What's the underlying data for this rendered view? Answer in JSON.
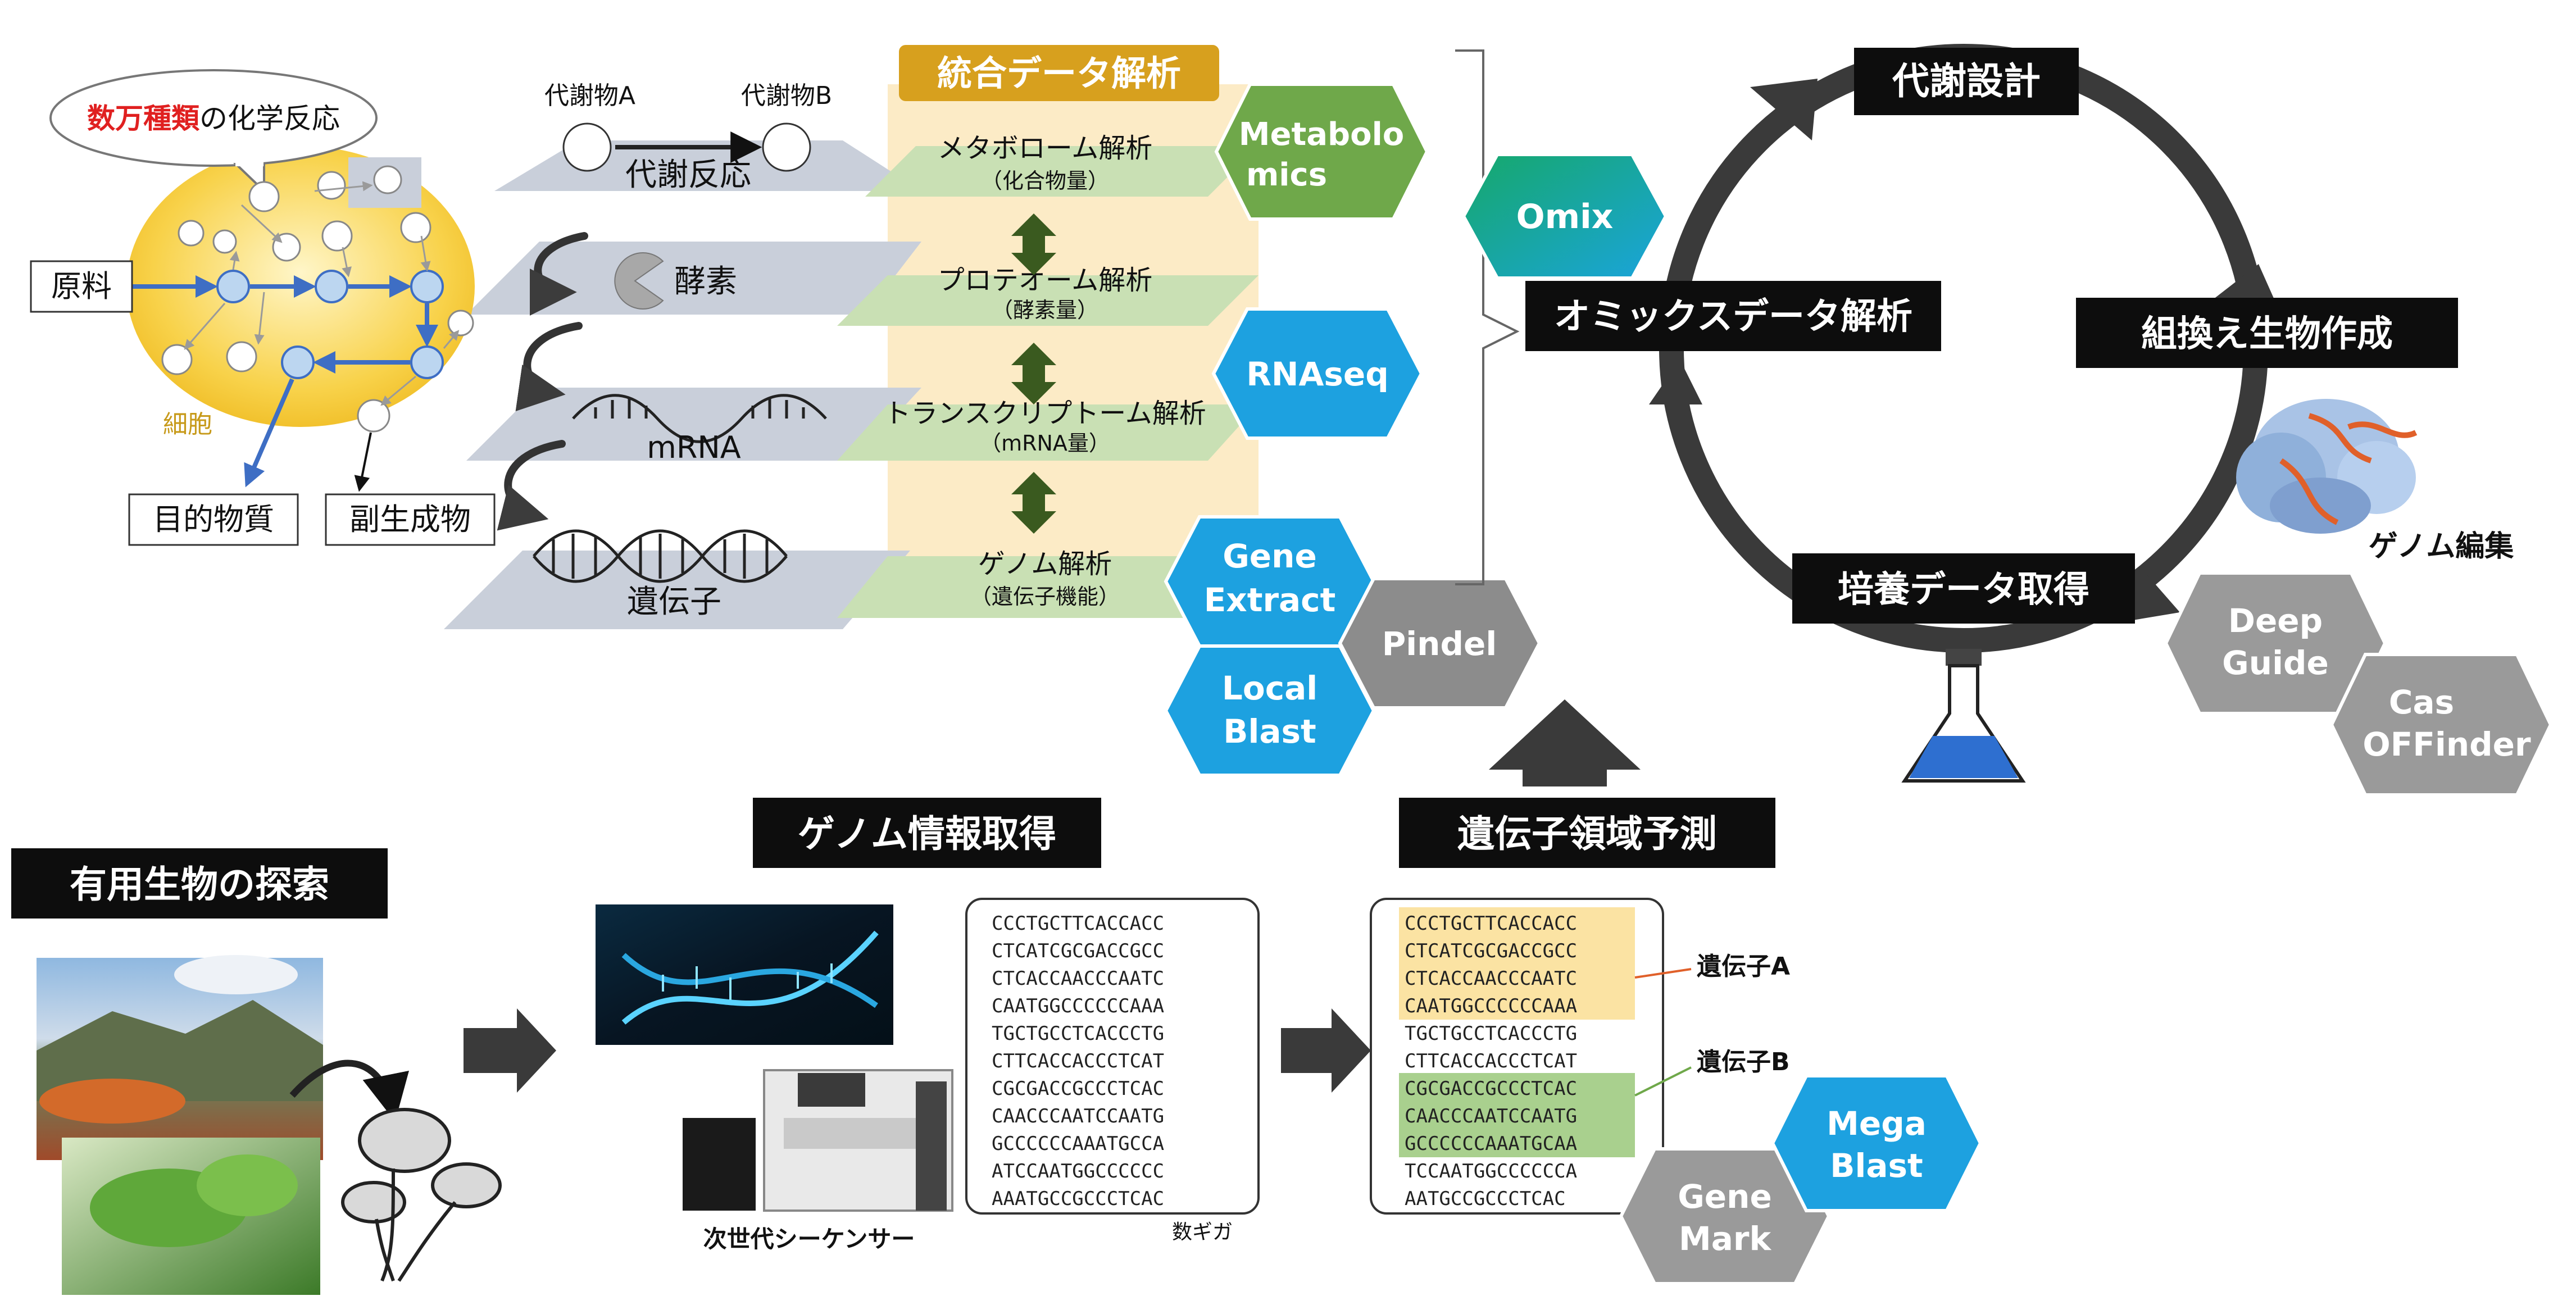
{
  "colors": {
    "hex_blue": "#1da1e0",
    "hex_green": "#6fa84a",
    "hex_gray": "#8c8c8c",
    "omix_start": "#16a86a",
    "omix_end": "#1aa4dc",
    "integrated_bg": "#fcebc6",
    "integrated_header": "#d7a01e",
    "label_black": "#0d0d0d",
    "accent_red": "#e02020",
    "cell_fill": "#f8d24a",
    "highlight_yellow": "#fbe3a3",
    "highlight_green": "#a9d08e",
    "arrow_dark": "#3c3c3c",
    "arrow_blue": "#3e6ec4"
  },
  "cell": {
    "bubble_highlight": "数万種類",
    "bubble_rest": "の化学反応",
    "raw_material": "原料",
    "cell_label": "細胞",
    "target_substance": "目的物質",
    "byproduct": "副生成物"
  },
  "layers": {
    "metabolite_a": "代謝物A",
    "metabolite_b": "代謝物B",
    "metabolic_reaction": "代謝反応",
    "enzyme": "酵素",
    "mrna": "mRNA",
    "gene": "遺伝子"
  },
  "integrated": {
    "title": "統合データ解析",
    "analyses": [
      {
        "title": "メタボローム解析",
        "sub": "（化合物量）"
      },
      {
        "title": "プロテオーム解析",
        "sub": "（酵素量）"
      },
      {
        "title": "トランスクリプトーム解析",
        "sub": "（mRNA量）"
      },
      {
        "title": "ゲノム解析",
        "sub": "（遺伝子機能）"
      }
    ]
  },
  "tools": {
    "metabolomics": [
      "Metabolo",
      "mics"
    ],
    "rnaseq": [
      "RNAseq"
    ],
    "gene_extract": [
      "Gene",
      "Extract"
    ],
    "pindel": [
      "Pindel"
    ],
    "local_blast": [
      "Local",
      "Blast"
    ],
    "omix": [
      "Omix"
    ],
    "deep_guide": [
      "Deep",
      "Guide"
    ],
    "cas_offinder": [
      "Cas",
      "OFFinder"
    ],
    "mega_blast": [
      "Mega",
      "Blast"
    ],
    "gene_mark": [
      "Gene",
      "Mark"
    ]
  },
  "cycle": {
    "metabolic_design": "代謝設計",
    "recombinant": "組換え生物作成",
    "culture_data": "培養データ取得",
    "omics_analysis": "オミックスデータ解析",
    "genome_editing": "ゲノム編集"
  },
  "bottom": {
    "search": "有用生物の探索",
    "genome_info": "ゲノム情報取得",
    "sequencer": "次世代シーケンサー",
    "gigabytes": "数ギガ",
    "gene_prediction": "遺伝子領域予測",
    "gene_a": "遺伝子A",
    "gene_b": "遺伝子B"
  },
  "sequence_lines": [
    "CCCTGCTTCACCACC",
    "CTCATCGCGACCGCC",
    "CTCACCAACCCAATC",
    "CAATGGCCCCCCAAA",
    "TGCTGCCTCACCCTG",
    "CTTCACCACCCTCAT",
    "CGCGACCGCCCTCAC",
    "CAACCCAATCCAATG",
    "GCCCCCCAAATGCCA",
    "ATCCAATGGCCCCCC",
    "AAATGCCGCCCTCAC"
  ],
  "predicted_lines": [
    "CCCTGCTTCACCACC",
    "CTCATCGCGACCGCC",
    "CTCACCAACCCAATC",
    "CAATGGCCCCCCAAA",
    "TGCTGCCTCACCCTG",
    "CTTCACCACCCTCAT",
    "CGCGACCGCCCTCAC",
    "CAACCCAATCCAATG",
    "GCCCCCCAAATGCAA",
    "TCCAATGGCCCCCCA",
    "AATGCCGCCCTCAC"
  ]
}
